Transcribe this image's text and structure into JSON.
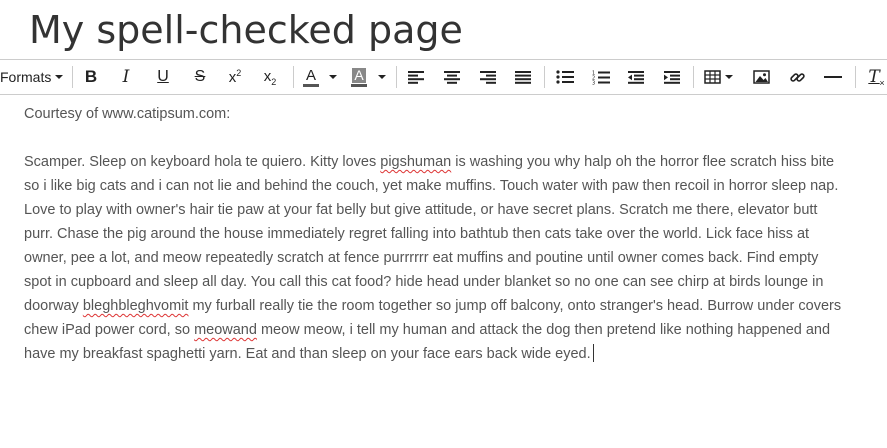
{
  "page": {
    "title": "My spell-checked page"
  },
  "toolbar": {
    "formats_label": "Formats",
    "buttons": {
      "bold": "B",
      "italic": "I",
      "underline": "U",
      "strikethrough": "S",
      "superscript_base": "x",
      "superscript_mark": "2",
      "subscript_base": "x",
      "subscript_mark": "2",
      "text_color": "A",
      "background_color": "A",
      "clear_formatting": "T"
    },
    "icons": [
      "bold",
      "italic",
      "underline",
      "strikethrough",
      "superscript",
      "subscript",
      "text-color",
      "background-color",
      "align-left",
      "align-center",
      "align-right",
      "justify",
      "bullet-list",
      "numbered-list",
      "outdent",
      "indent",
      "table",
      "image",
      "link",
      "horizontal-rule",
      "clear-formatting"
    ]
  },
  "editor": {
    "p1": "Courtesy of www.catipsum.com:",
    "p2": {
      "s1": "Scamper. Sleep on keyboard hola te quiero. Kitty loves ",
      "w1": "pigshuman",
      "s2": " is washing you why halp oh the horror flee scratch hiss bite so i like big cats and i can not lie and behind the couch, yet make muffins. Touch water with paw then recoil in horror sleep nap. Love to play with owner's hair tie paw at your fat belly but give attitude, or have secret plans. Scratch me there, elevator butt purr. Chase the pig around the house immediately regret falling into bathtub then cats take over the world. Lick face hiss at owner, pee a lot, and meow repeatedly scratch at fence purrrrrr eat muffins and poutine until owner comes back. Find empty spot in cupboard and sleep all day. You call this cat food? hide head under blanket so no one can see chirp at birds lounge in doorway ",
      "w2": "bleghbleghvomit",
      "s3": " my furball really tie the room together so jump off balcony, onto stranger's head. Burrow under covers chew iPad power cord, so ",
      "w3": "meowand",
      "s4": " meow meow, i tell my human and attack the dog then pretend like nothing happened and have my breakfast spaghetti yarn. Eat and than sleep on your face ears back wide eyed."
    }
  }
}
